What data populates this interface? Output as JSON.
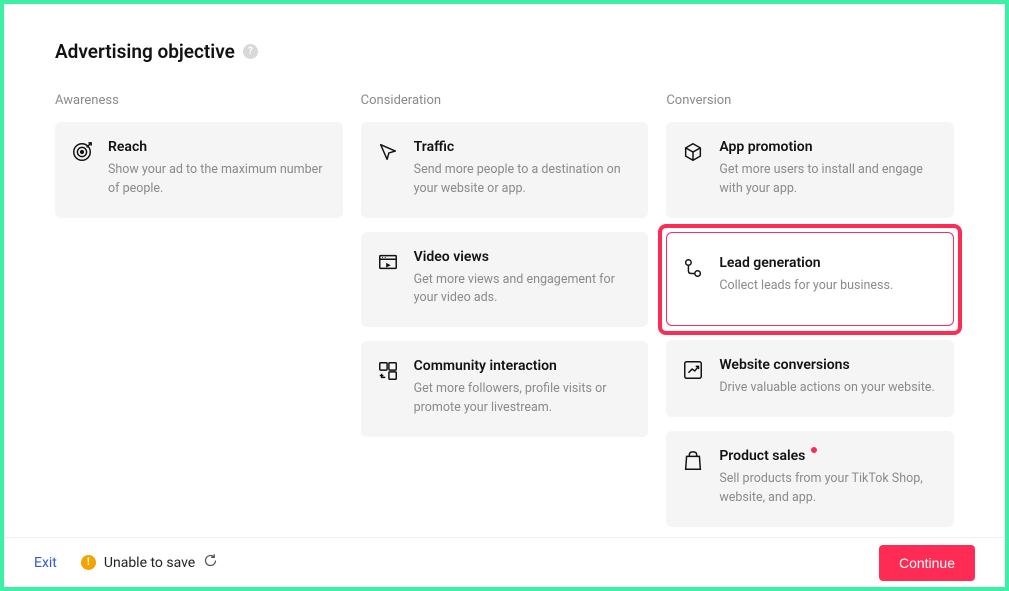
{
  "heading": "Advertising objective",
  "columns": {
    "awareness": {
      "label": "Awareness"
    },
    "consideration": {
      "label": "Consideration"
    },
    "conversion": {
      "label": "Conversion"
    }
  },
  "cards": {
    "reach": {
      "title": "Reach",
      "desc": "Show your ad to the maximum number of people."
    },
    "traffic": {
      "title": "Traffic",
      "desc": "Send more people to a destination on your website or app."
    },
    "video_views": {
      "title": "Video views",
      "desc": "Get more views and engagement for your video ads."
    },
    "community": {
      "title": "Community interaction",
      "desc": "Get more followers, profile visits or promote your livestream."
    },
    "app_promotion": {
      "title": "App promotion",
      "desc": "Get more users to install and engage with your app."
    },
    "lead_gen": {
      "title": "Lead generation",
      "desc": "Collect leads for your business."
    },
    "website_conv": {
      "title": "Website conversions",
      "desc": "Drive valuable actions on your website."
    },
    "product_sales": {
      "title": "Product sales",
      "desc": "Sell products from your TikTok Shop, website, and app."
    }
  },
  "footer": {
    "exit": "Exit",
    "status": "Unable to save",
    "continue": "Continue"
  }
}
